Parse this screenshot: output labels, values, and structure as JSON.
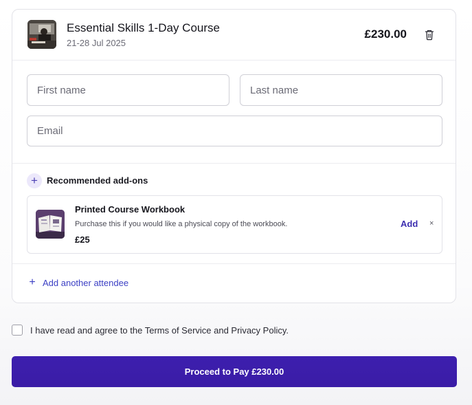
{
  "course": {
    "title": "Essential Skills 1-Day Course",
    "dates": "21-28 Jul 2025",
    "price": "£230.00",
    "delete_icon": "trash-icon"
  },
  "form": {
    "first_name_placeholder": "First name",
    "last_name_placeholder": "Last name",
    "email_placeholder": "Email"
  },
  "addons": {
    "heading": "Recommended add-ons",
    "heading_icon": "plus-icon",
    "items": [
      {
        "title": "Printed Course Workbook",
        "description": "Purchase this if you would like a physical copy of the workbook.",
        "price": "£25",
        "add_label": "Add",
        "dismiss_label": "×"
      }
    ]
  },
  "add_attendee": {
    "label": "Add another attendee",
    "icon": "plus-icon"
  },
  "terms": {
    "label": "I have read and agree to the Terms of Service and Privacy Policy.",
    "checked": false
  },
  "pay_button": {
    "label": "Proceed to Pay £230.00"
  },
  "colors": {
    "accent": "#3a1ca6",
    "link": "#3b3fc4",
    "border": "#e2e2e8"
  }
}
